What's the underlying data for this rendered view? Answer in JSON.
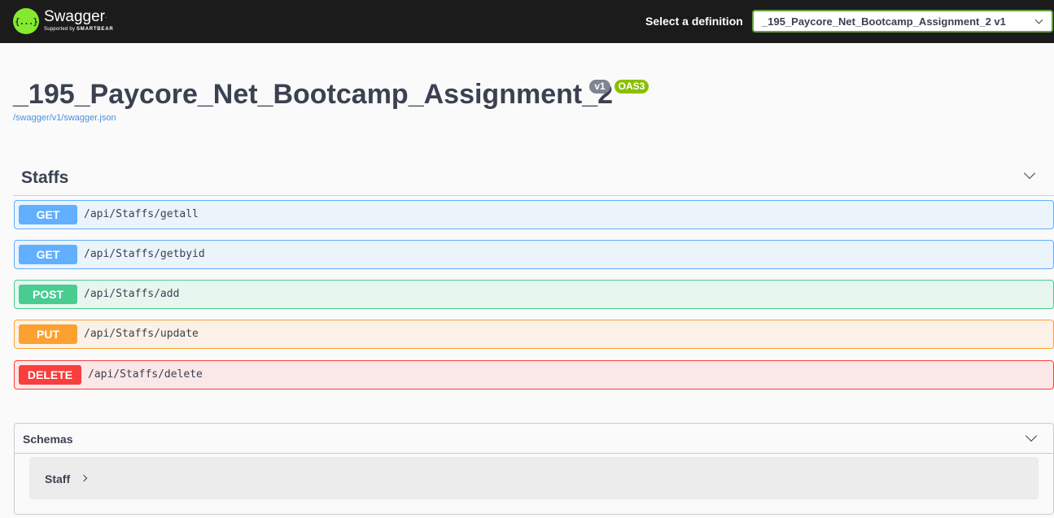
{
  "topbar": {
    "logo_icon": "{...}",
    "logo_name": "Swagger",
    "logo_tm": ".",
    "logo_sub_prefix": "Supported by ",
    "logo_sub_brand": "SMARTBEAR",
    "definition_label": "Select a definition",
    "definition_selected": "_195_Paycore_Net_Bootcamp_Assignment_2 v1"
  },
  "info": {
    "title": "_195_Paycore_Net_Bootcamp_Assignment_2",
    "version_badge": "v1",
    "oas_badge": "OAS3",
    "spec_url": "/swagger/v1/swagger.json"
  },
  "tag": {
    "name": "Staffs"
  },
  "operations": [
    {
      "method": "GET",
      "path": "/api/Staffs/getall"
    },
    {
      "method": "GET",
      "path": "/api/Staffs/getbyid"
    },
    {
      "method": "POST",
      "path": "/api/Staffs/add"
    },
    {
      "method": "PUT",
      "path": "/api/Staffs/update"
    },
    {
      "method": "DELETE",
      "path": "/api/Staffs/delete"
    }
  ],
  "schemas": {
    "title": "Schemas",
    "models": [
      "Staff"
    ]
  },
  "colors": {
    "get": "#61affe",
    "post": "#49cc90",
    "put": "#fca130",
    "delete": "#f93e3e",
    "topbar": "#1b1b1b",
    "logo": "#85ea2d"
  }
}
